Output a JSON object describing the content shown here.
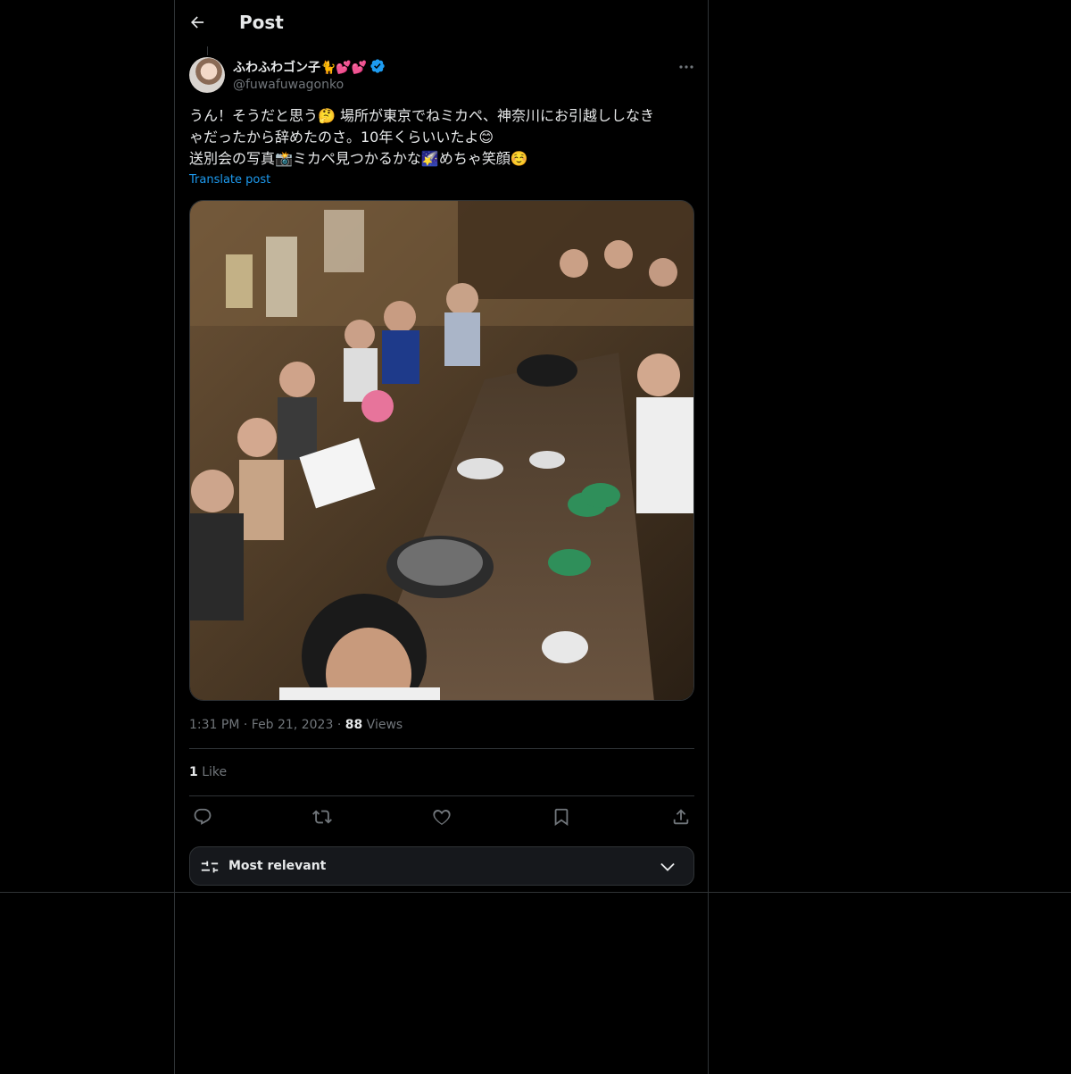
{
  "header": {
    "title": "Post"
  },
  "author": {
    "display_name": "ふわふわゴン子🐈💕💕",
    "handle": "@fuwafuwagonko",
    "verified": true
  },
  "post": {
    "lines": [
      "うん！そうだと思う🤔 場所が東京でねミカペ、神奈川にお引越ししなき",
      "ゃだったから辞めたのさ。10年くらいいたよ😊",
      "送別会の写真📸ミカペ見つかるかな🌠めちゃ笑顔☺️"
    ],
    "translate_label": "Translate post"
  },
  "meta": {
    "time": "1:31 PM",
    "sep1": "·",
    "date": "Feb 21, 2023",
    "sep2": "·",
    "views_count": "88",
    "views_label": "Views"
  },
  "stats": {
    "likes_count": "1",
    "likes_label": "Like"
  },
  "sort": {
    "label": "Most relevant"
  },
  "colors": {
    "accent": "#1d9bf0",
    "background": "#000000",
    "border": "#2f3336",
    "muted": "#71767b"
  }
}
